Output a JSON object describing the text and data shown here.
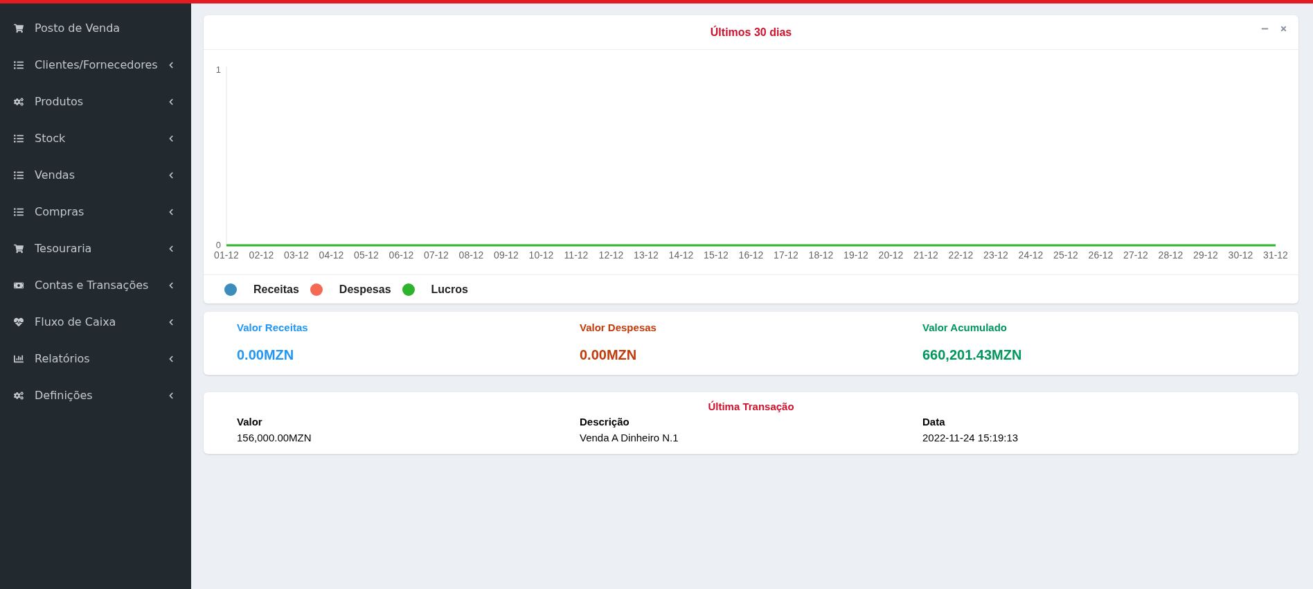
{
  "sidebar": {
    "items": [
      {
        "label": "Posto de Venda",
        "has_submenu": false
      },
      {
        "label": "Clientes/Fornecedores",
        "has_submenu": true
      },
      {
        "label": "Produtos",
        "has_submenu": true
      },
      {
        "label": "Stock",
        "has_submenu": true
      },
      {
        "label": "Vendas",
        "has_submenu": true
      },
      {
        "label": "Compras",
        "has_submenu": true
      },
      {
        "label": "Tesouraria",
        "has_submenu": true
      },
      {
        "label": "Contas e Transações",
        "has_submenu": true
      },
      {
        "label": "Fluxo de Caixa",
        "has_submenu": true
      },
      {
        "label": "Relatórios",
        "has_submenu": true
      },
      {
        "label": "Definições",
        "has_submenu": true
      }
    ]
  },
  "chart_card": {
    "title": "Últimos 30 dias",
    "chart_data": {
      "type": "line",
      "categories": [
        "01-12",
        "02-12",
        "03-12",
        "04-12",
        "05-12",
        "06-12",
        "07-12",
        "08-12",
        "09-12",
        "10-12",
        "11-12",
        "12-12",
        "13-12",
        "14-12",
        "15-12",
        "16-12",
        "17-12",
        "18-12",
        "19-12",
        "20-12",
        "21-12",
        "22-12",
        "23-12",
        "24-12",
        "25-12",
        "26-12",
        "27-12",
        "28-12",
        "29-12",
        "30-12",
        "31-12"
      ],
      "yticks": [
        0,
        1
      ],
      "ylim": [
        0,
        1
      ],
      "series": [
        {
          "name": "Receitas",
          "color": "#3c8dbc",
          "values": [
            null,
            null,
            null,
            null,
            null,
            null,
            null,
            null,
            null,
            null,
            null,
            null,
            null,
            null,
            null,
            null,
            null,
            null,
            null,
            null,
            null,
            null,
            null,
            null,
            null,
            null,
            null,
            null,
            null,
            null,
            null
          ]
        },
        {
          "name": "Despesas",
          "color": "#f56954",
          "values": [
            null,
            null,
            null,
            null,
            null,
            null,
            null,
            null,
            null,
            null,
            null,
            null,
            null,
            null,
            null,
            null,
            null,
            null,
            null,
            null,
            null,
            null,
            null,
            null,
            null,
            null,
            null,
            null,
            null,
            null,
            null
          ]
        },
        {
          "name": "Lucros",
          "color": "#2fb32a",
          "values": [
            0,
            0,
            0,
            0,
            0,
            0,
            0,
            0,
            0,
            0,
            0,
            0,
            0,
            0,
            0,
            0,
            0,
            0,
            0,
            0,
            0,
            0,
            0,
            0,
            0,
            0,
            0,
            0,
            0,
            0,
            0
          ]
        }
      ]
    }
  },
  "stats": [
    {
      "label": "Valor Receitas",
      "value": "0.00MZN",
      "color": "#2196f3"
    },
    {
      "label": "Valor Despesas",
      "value": "0.00MZN",
      "color": "#c23a0a"
    },
    {
      "label": "Valor Acumulado",
      "value": "660,201.43MZN",
      "color": "#00965e"
    }
  ],
  "last_transaction": {
    "title": "Última Transação",
    "columns": [
      {
        "heading": "Valor",
        "value": "156,000.00MZN"
      },
      {
        "heading": "Descrição",
        "value": "Venda A Dinheiro N.1"
      },
      {
        "heading": "Data",
        "value": "2022-11-24 15:19:13"
      }
    ]
  }
}
